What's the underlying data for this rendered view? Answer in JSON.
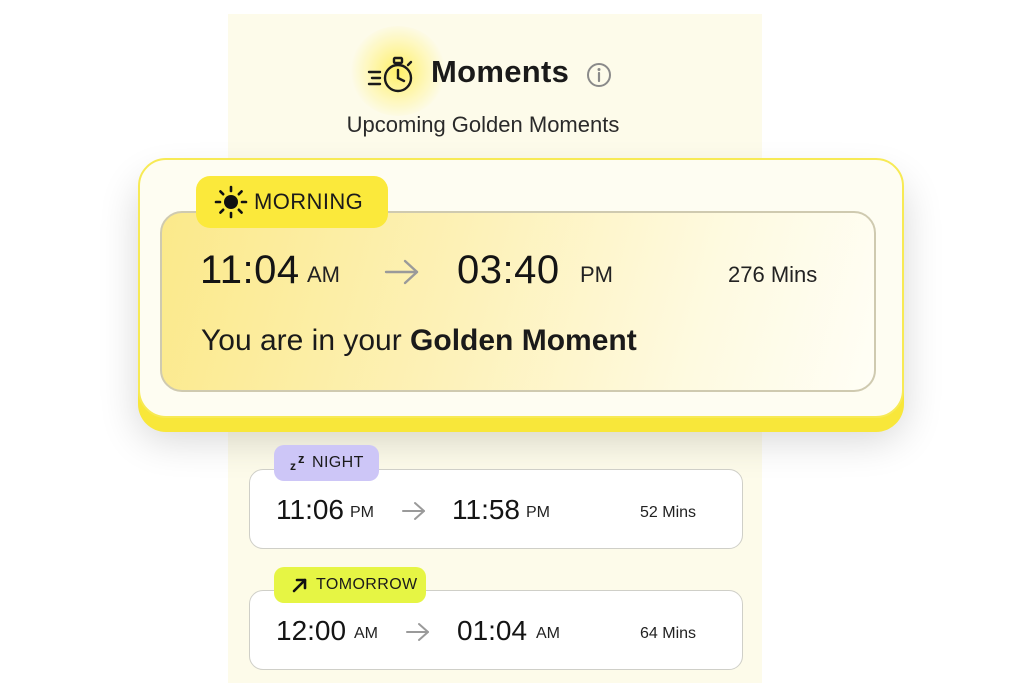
{
  "header": {
    "title": "Moments",
    "subtitle": "Upcoming Golden Moments",
    "timer_icon": "stopwatch-icon",
    "info_icon": "info-icon"
  },
  "current_moment": {
    "chip_label": "MORNING",
    "chip_icon": "sun-icon",
    "start_time": "11:04",
    "start_period": "AM",
    "end_time": "03:40",
    "end_period": "PM",
    "duration": "276 Mins",
    "status_prefix": "You are in your",
    "status_emphasis": "Golden Moment"
  },
  "upcoming": [
    {
      "chip_label": "NIGHT",
      "chip_icon": "sleep-zz-icon",
      "start_time": "11:06",
      "start_period": "PM",
      "end_time": "11:58",
      "end_period": "PM",
      "duration": "52 Mins"
    },
    {
      "chip_label": "TOMORROW",
      "chip_icon": "arrow-up-right-icon",
      "start_time": "12:00",
      "start_period": "AM",
      "end_time": "01:04",
      "end_period": "AM",
      "duration": "64 Mins"
    }
  ],
  "colors": {
    "panel_bg": "#fdfbea",
    "accent_yellow": "#fbe93b",
    "night_chip": "#cdc6f7",
    "tomorrow_chip": "#e6f544"
  }
}
